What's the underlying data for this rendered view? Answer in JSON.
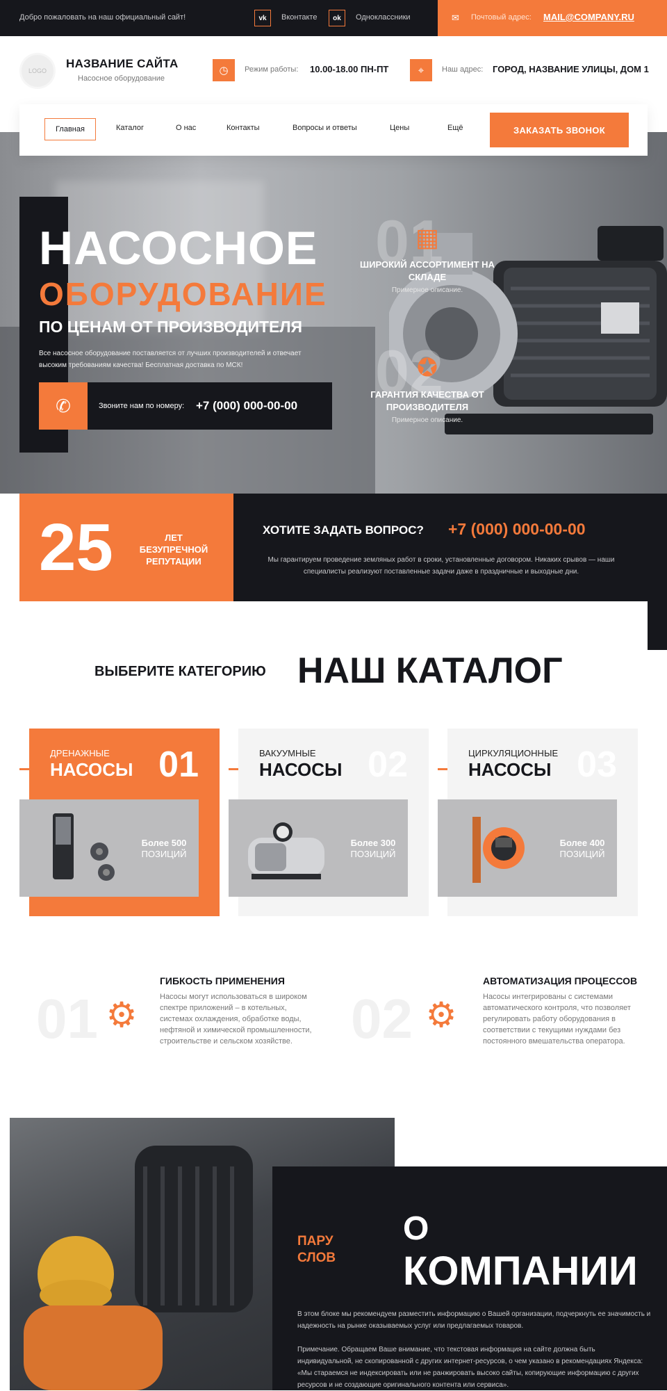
{
  "topbar": {
    "welcome": "Добро пожаловать на наш официальный сайт!",
    "vk": "Вконтакте",
    "ok": "Одноклассники",
    "mail_label": "Почтовый адрес:",
    "mail": "MAIL@COMPANY.RU"
  },
  "header": {
    "logo": "LOGO",
    "site_name": "НАЗВАНИЕ САЙТА",
    "site_sub": "Насосное оборудование",
    "hours_label": "Режим работы:",
    "hours": "10.00-18.00 ПН-ПТ",
    "address_label": "Наш адрес:",
    "address": "ГОРОД, НАЗВАНИЕ УЛИЦЫ, ДОМ 1"
  },
  "nav": {
    "items": [
      "Главная",
      "Каталог",
      "О нас",
      "Контакты",
      "Вопросы и ответы",
      "Цены",
      "Ещё"
    ],
    "cta": "ЗАКАЗАТЬ ЗВОНОК"
  },
  "hero": {
    "line1": "НАСОСНОЕ",
    "line2": "ОБОРУДОВАНИЕ",
    "line3": "ПО ЦЕНАМ ОТ ПРОИЗВОДИТЕЛЯ",
    "desc": "Все насосное оборудование поставляется от лучших производителей и отвечает высоким требованиям качества! Бесплатная доставка по МСК!",
    "phone_label": "Звоните нам по номеру:",
    "phone": "+7 (000) 000-00-00",
    "features": [
      {
        "num": "01",
        "title": "ШИРОКИЙ АССОРТИМЕНТ НА СКЛАДЕ",
        "sub": "Примерное описание."
      },
      {
        "num": "02",
        "title": "ГАРАНТИЯ КАЧЕСТВА ОТ ПРОИЗВОДИТЕЛЯ",
        "sub": "Примерное описание."
      }
    ]
  },
  "stats": {
    "years": "25",
    "years_label": "ЛЕТ БЕЗУПРЕЧНОЙ РЕПУТАЦИИ",
    "question": "ХОТИТЕ ЗАДАТЬ ВОПРОС?",
    "phone": "+7 (000) 000-00-00",
    "desc": "Мы гарантируем проведение земляных работ в сроки, установленные договором. Никаких срывов — наши специалисты реализуют поставленные задачи даже в праздничные и выходные дни."
  },
  "catalog": {
    "pre": "ВЫБЕРИТЕ КАТЕГОРИЮ",
    "title": "НАШ КАТАЛОГ",
    "cards": [
      {
        "type": "ДРЕНАЖНЫЕ",
        "name": "НАСОСЫ",
        "num": "01",
        "count": "Более 500",
        "unit": "ПОЗИЦИЙ"
      },
      {
        "type": "ВАКУУМНЫЕ",
        "name": "НАСОСЫ",
        "num": "02",
        "count": "Более 300",
        "unit": "ПОЗИЦИЙ"
      },
      {
        "type": "ЦИРКУЛЯЦИОННЫЕ",
        "name": "НАСОСЫ",
        "num": "03",
        "count": "Более 400",
        "unit": "ПОЗИЦИЙ"
      }
    ]
  },
  "features": [
    {
      "num": "01",
      "title": "ГИБКОСТЬ ПРИМЕНЕНИЯ",
      "desc": "Насосы могут использоваться в широком спектре приложений – в котельных, системах охлаждения, обработке воды, нефтяной и химической промышленности, строительстве и сельском хозяйстве."
    },
    {
      "num": "02",
      "title": "АВТОМАТИЗАЦИЯ ПРОЦЕССОВ",
      "desc": "Насосы интегрированы с системами автоматического контроля, что позволяет регулировать работу оборудования в соответствии с текущими нуждами без постоянного вмешательства оператора."
    }
  ],
  "about": {
    "pre1": "ПАРУ",
    "pre2": "СЛОВ",
    "o": "О",
    "title": "КОМПАНИИ",
    "p1": "В этом блоке мы рекомендуем разместить информацию о Вашей организации, подчеркнуть ее значимость и надежность на рынке оказываемых услуг или предлагаемых товаров.",
    "p2": "Примечание. Обращаем Ваше внимание, что текстовая информация на сайте должна быть индивидуальной, не скопированной с других интернет-ресурсов, о чем указано в рекомендациях Яндекса: «Мы стараемся не индексировать или не ранжировать высоко сайты, копирующие информацию с других ресурсов и не создающие оригинального контента или сервиса»."
  },
  "colors": {
    "accent": "#f47a3b",
    "dark": "#16171c"
  }
}
